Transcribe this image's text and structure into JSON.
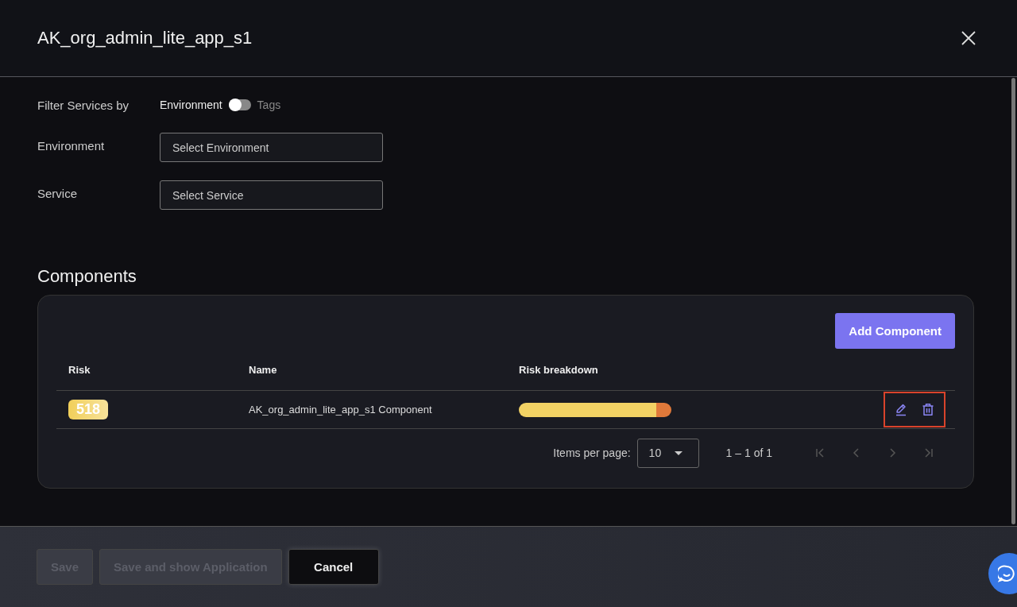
{
  "dialog": {
    "title": "AK_org_admin_lite_app_s1"
  },
  "filter": {
    "label": "Filter Services by",
    "left_option": "Environment",
    "right_option": "Tags",
    "on": false
  },
  "fields": [
    {
      "label": "Environment",
      "placeholder": "Select Environment"
    },
    {
      "label": "Service",
      "placeholder": "Select Service"
    }
  ],
  "components": {
    "heading": "Components",
    "add_button": "Add Component",
    "columns": [
      "Risk",
      "Name",
      "Risk breakdown"
    ],
    "rows": [
      {
        "risk": "518",
        "name": "AK_org_admin_lite_app_s1 Component",
        "breakdown": [
          {
            "level": 0.9,
            "color": "#f2d264"
          },
          {
            "level": 0.1,
            "color": "#e0793a"
          }
        ],
        "actions_highlighted": true
      }
    ],
    "pagination": {
      "label": "Items per page:",
      "page_size": "10",
      "range": "1 – 1 of 1",
      "first_disabled": true,
      "prev_disabled": true,
      "next_disabled": true,
      "last_disabled": true
    }
  },
  "footer": {
    "buttons": [
      {
        "label": "Save",
        "disabled": true
      },
      {
        "label": "Save and show Application",
        "disabled": true
      },
      {
        "label": "Cancel",
        "disabled": false
      }
    ]
  }
}
